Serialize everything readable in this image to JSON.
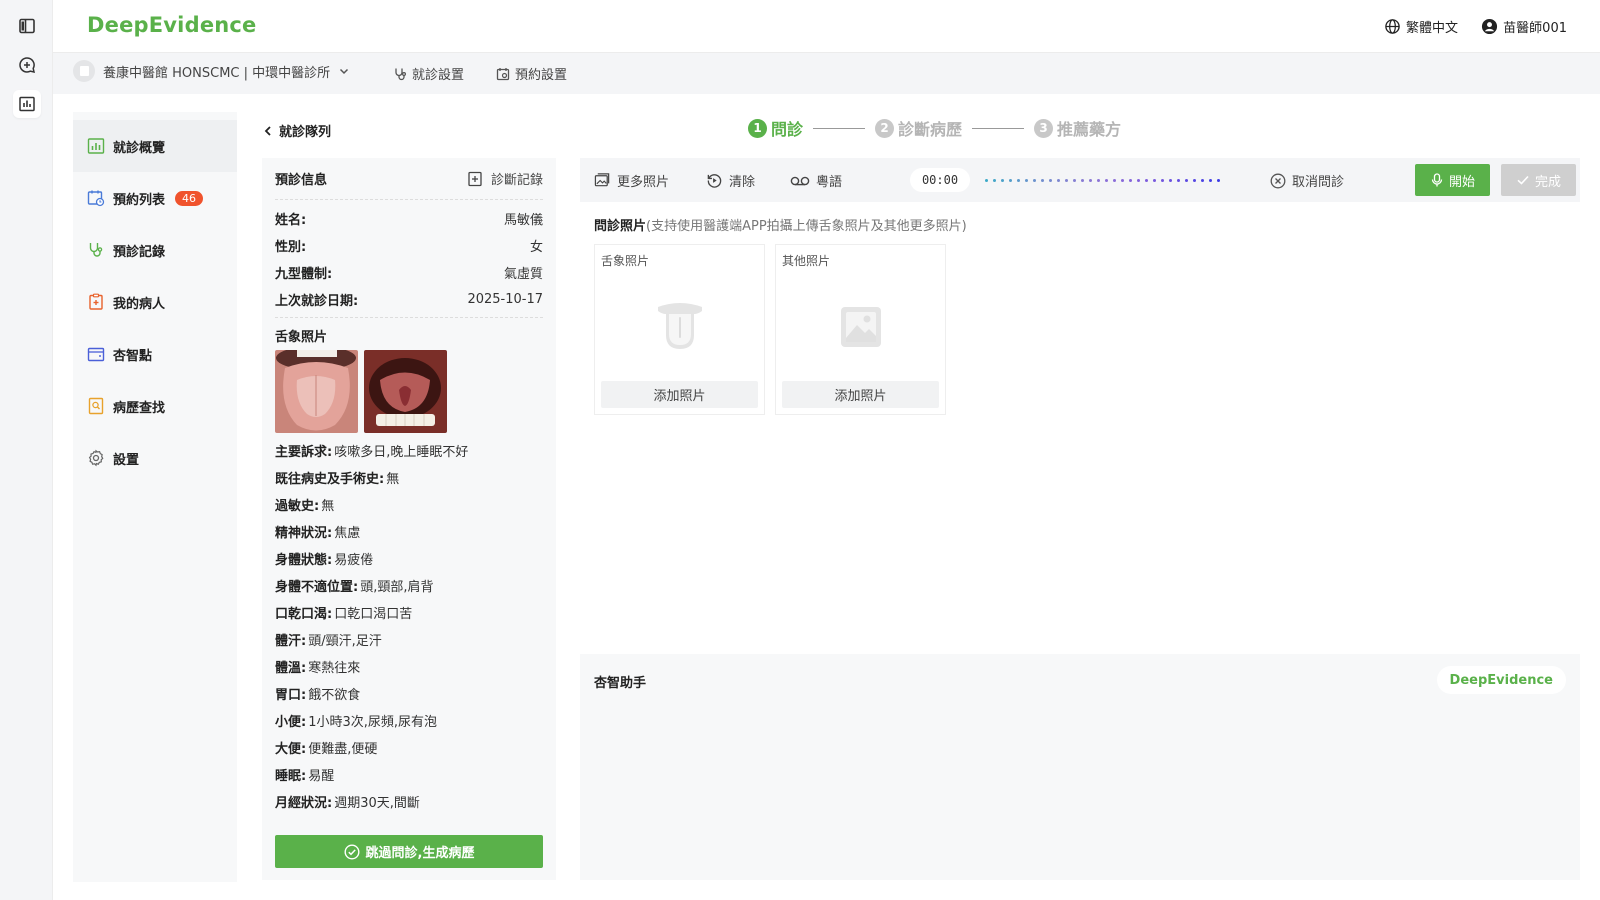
{
  "brand": {
    "logo": "DeepEvidence",
    "accent": "#5ab14a"
  },
  "header": {
    "language": "繁體中文",
    "user": "苗醫師001"
  },
  "subbar": {
    "clinic": "養康中醫館 HONSCMC | 中環中醫診所",
    "visit_settings": "就診設置",
    "appointment_settings": "預約設置"
  },
  "menu": {
    "items": [
      {
        "label": "就診概覽"
      },
      {
        "label": "預約列表",
        "badge": "46"
      },
      {
        "label": "預診記錄"
      },
      {
        "label": "我的病人"
      },
      {
        "label": "杏智點"
      },
      {
        "label": "病歷查找"
      },
      {
        "label": "設置"
      }
    ]
  },
  "back_link": "就診隊列",
  "stepper": {
    "steps": [
      {
        "num": "1",
        "label": "問診",
        "active": true
      },
      {
        "num": "2",
        "label": "診斷病歷",
        "active": false
      },
      {
        "num": "3",
        "label": "推薦藥方",
        "active": false
      }
    ]
  },
  "info": {
    "title": "預診信息",
    "diag_link": "診斷記錄",
    "fields": [
      {
        "k": "姓名:",
        "v": "馬敏儀"
      },
      {
        "k": "性別:",
        "v": "女"
      },
      {
        "k": "九型體制:",
        "v": "氣虛質"
      },
      {
        "k": "上次就診日期:",
        "v": "2025-10-17"
      }
    ],
    "tongue_title": "舌象照片",
    "symptoms": [
      {
        "k": "主要訴求:",
        "v": "咳嗽多日,晚上睡眠不好"
      },
      {
        "k": "既往病史及手術史:",
        "v": "無"
      },
      {
        "k": "過敏史:",
        "v": "無"
      },
      {
        "k": "精神狀況:",
        "v": "焦慮"
      },
      {
        "k": "身體狀態:",
        "v": "易疲倦"
      },
      {
        "k": "身體不適位置:",
        "v": "頭,頸部,肩背"
      },
      {
        "k": "口乾口渴:",
        "v": "口乾口渴口苦"
      },
      {
        "k": "體汗:",
        "v": "頭/頸汗,足汗"
      },
      {
        "k": "體溫:",
        "v": "寒熱往來"
      },
      {
        "k": "胃口:",
        "v": "餓不欲食"
      },
      {
        "k": "小便:",
        "v": "1小時3次,尿頻,尿有泡"
      },
      {
        "k": "大便:",
        "v": "便難盡,便硬"
      },
      {
        "k": "睡眠:",
        "v": "易醒"
      },
      {
        "k": "月經狀況:",
        "v": "週期30天,間斷"
      }
    ],
    "skip_button": "跳過問診,生成病歷"
  },
  "toolbar": {
    "more_photos": "更多照片",
    "clear": "清除",
    "language": "粵語",
    "timer": "00:00",
    "cancel": "取消問診",
    "start": "開始",
    "done": "完成"
  },
  "photos": {
    "title": "問診照片",
    "hint": "(支持使用醫護端APP拍攝上傳舌象照片及其他更多照片)",
    "cards": [
      {
        "label": "舌象照片",
        "button": "添加照片"
      },
      {
        "label": "其他照片",
        "button": "添加照片"
      }
    ]
  },
  "assistant": {
    "title": "杏智助手",
    "badge": "DeepEvidence"
  }
}
